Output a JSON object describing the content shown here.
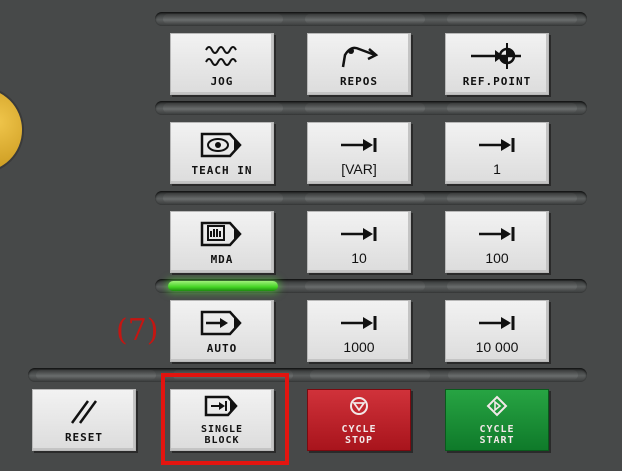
{
  "callout": "(7)",
  "colors": {
    "panel": "#474949",
    "key_face": "#e6e6e6",
    "cycle_stop": "#c0242c",
    "cycle_start": "#1a9238",
    "led_active": "#44d424",
    "highlight": "#e2140f",
    "knob": "#d8a828"
  },
  "rows": [
    {
      "keys": [
        {
          "label": "JOG",
          "icon": "jog-wave-icon"
        },
        {
          "label": "REPOS",
          "icon": "repos-curve-icon"
        },
        {
          "label": "REF.POINT",
          "icon": "ref-point-icon"
        }
      ]
    },
    {
      "keys": [
        {
          "label": "TEACH IN",
          "icon": "teach-in-icon"
        },
        {
          "label": "[VAR]",
          "icon": "increment-arrow-icon"
        },
        {
          "label": "1",
          "icon": "increment-arrow-icon"
        }
      ]
    },
    {
      "keys": [
        {
          "label": "MDA",
          "icon": "mda-hand-icon"
        },
        {
          "label": "10",
          "icon": "increment-arrow-icon"
        },
        {
          "label": "100",
          "icon": "increment-arrow-icon"
        }
      ]
    },
    {
      "keys": [
        {
          "label": "AUTO",
          "icon": "auto-arrow-icon"
        },
        {
          "label": "1000",
          "icon": "increment-arrow-icon"
        },
        {
          "label": "10 000",
          "icon": "increment-arrow-icon"
        }
      ]
    }
  ],
  "bottom": {
    "reset": {
      "label": "RESET",
      "icon": "reset-slash-icon"
    },
    "single_block": {
      "label": "SINGLE\nBLOCK",
      "icon": "single-block-icon",
      "highlighted": true
    },
    "cycle_stop": {
      "label": "CYCLE\nSTOP",
      "icon": "stop-circle-icon"
    },
    "cycle_start": {
      "label": "CYCLE\nSTART",
      "icon": "start-diamond-icon"
    }
  },
  "indicator": {
    "lit_row": 3,
    "state": "on"
  }
}
